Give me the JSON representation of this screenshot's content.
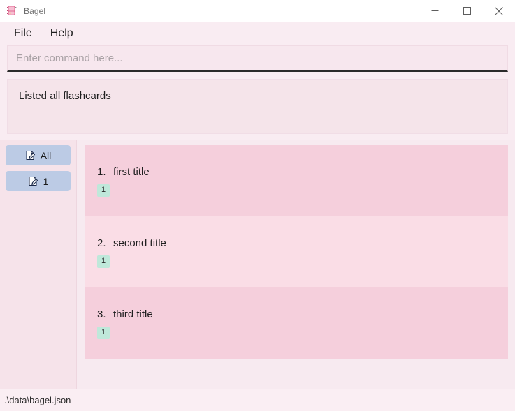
{
  "window": {
    "title": "Bagel",
    "icon": "bagel-app-icon",
    "controls": [
      {
        "name": "minimize",
        "glyph": "minimize-icon"
      },
      {
        "name": "maximize",
        "glyph": "maximize-icon"
      },
      {
        "name": "close",
        "glyph": "close-icon"
      }
    ]
  },
  "menubar": {
    "items": [
      {
        "label": "File"
      },
      {
        "label": "Help"
      }
    ]
  },
  "command": {
    "value": "",
    "placeholder": "Enter command here..."
  },
  "result": {
    "text": "Listed all flashcards"
  },
  "sidebar": {
    "decks": [
      {
        "label": "All",
        "icon": "note-edit-icon"
      },
      {
        "label": "1",
        "icon": "note-edit-icon"
      }
    ]
  },
  "cards": [
    {
      "index": "1.",
      "title": "first title",
      "tags": [
        "1"
      ],
      "shade": "dark"
    },
    {
      "index": "2.",
      "title": "second title",
      "tags": [
        "1"
      ],
      "shade": "light"
    },
    {
      "index": "3.",
      "title": "third title",
      "tags": [
        "1"
      ],
      "shade": "dark"
    }
  ],
  "statusbar": {
    "path": ".\\data\\bagel.json"
  },
  "colors": {
    "accent_pink": "#f5cfdc",
    "panel_pink": "#f9ecf2",
    "sidebar_pink": "#f6e3ea",
    "deck_button_blue": "#bccbe5",
    "tag_green": "#bfe8da",
    "titlebar_white": "#ffffff",
    "text_dark": "#1f1f1f",
    "placeholder_gray": "#a9a1a5"
  }
}
